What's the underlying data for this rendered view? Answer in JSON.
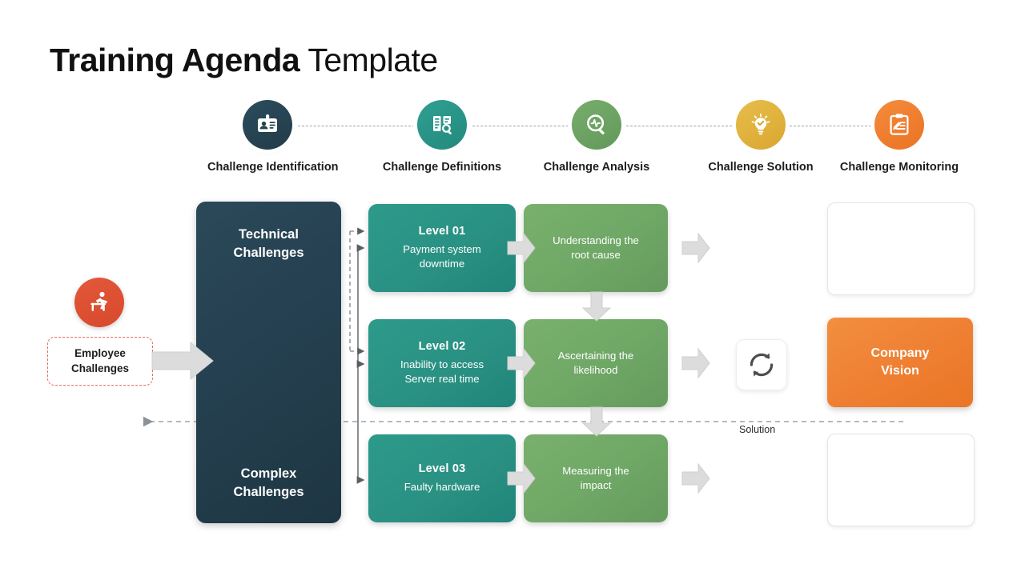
{
  "title": {
    "bold": "Training Agenda",
    "regular": "Template"
  },
  "colors": {
    "navy": "#254050",
    "teal": "#2a9183",
    "green": "#6fa766",
    "orange": "#ef8033",
    "gold": "#e0b23c",
    "red": "#d8492c",
    "arrow_grey": "#dcdcdc",
    "dash_grey": "#9aa3a8"
  },
  "steps": [
    {
      "label": "Challenge Identification",
      "icon": "id-badge-icon",
      "color": "#24414f"
    },
    {
      "label": "Challenge Definitions",
      "icon": "book-search-icon",
      "color": "#269184"
    },
    {
      "label": "Challenge Analysis",
      "icon": "magnifier-pulse-icon",
      "color": "#6ba463"
    },
    {
      "label": "Challenge Solution",
      "icon": "lightbulb-check-icon",
      "color": "#e0b23c"
    },
    {
      "label": "Challenge Monitoring",
      "icon": "clipboard-pen-icon",
      "color": "#ef7f2e"
    }
  ],
  "entry": {
    "icon": "hurdle-runner-icon",
    "label": "Employee\nChallenges",
    "label_line1": "Employee",
    "label_line2": "Challenges"
  },
  "panel": {
    "top_line1": "Technical",
    "top_line2": "Challenges",
    "bottom_line1": "Complex",
    "bottom_line2": "Challenges"
  },
  "levels": [
    {
      "heading": "Level 01",
      "line1": "Payment system",
      "line2": "downtime"
    },
    {
      "heading": "Level 02",
      "line1": "Inability to access",
      "line2": "Server real time"
    },
    {
      "heading": "Level 03",
      "line1": "Faulty hardware",
      "line2": ""
    }
  ],
  "analysis": [
    {
      "line1": "Understanding the",
      "line2": "root cause"
    },
    {
      "line1": "Ascertaining the",
      "line2": "likelihood"
    },
    {
      "line1": "Measuring the",
      "line2": "impact"
    }
  ],
  "vision": {
    "line1": "Company",
    "line2": "Vision"
  },
  "refresh": {
    "icon": "refresh-cycle-icon"
  },
  "feedback": {
    "label": "Solution"
  },
  "placeholders": [
    {
      "label": ""
    },
    {
      "label": ""
    }
  ]
}
